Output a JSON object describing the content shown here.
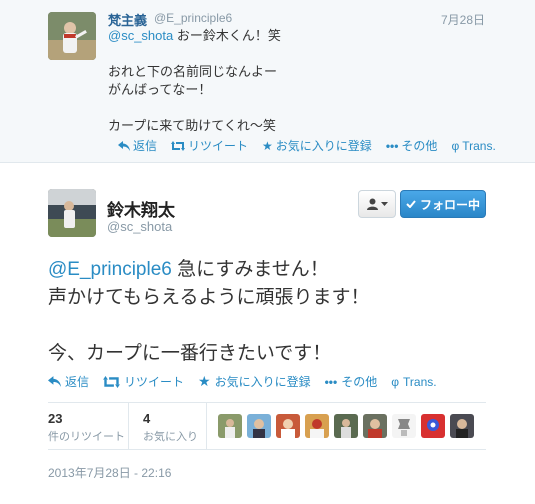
{
  "reply_tweet": {
    "name": "梵主義",
    "handle": "@E_principle6",
    "time": "7月28日",
    "mention": "@sc_shota",
    "body": " おー鈴木くん！笑\n\nおれと下の名前同じなんよー\nがんばってなー！\n\nカープに来て助けてくれ〜笑",
    "actions": {
      "reply": "返信",
      "retweet": "リツイート",
      "favorite": "お気に入りに登録",
      "more": "その他",
      "translate": "Trans."
    }
  },
  "main_tweet": {
    "name": "鈴木翔太",
    "handle": "@sc_shota",
    "follow_label": "フォロー中",
    "mention": "@E_principle6",
    "body": " 急にすみません！\n声かけてもらえるように頑張ります！\n\n今、カープに一番行きたいです！",
    "actions": {
      "reply": "返信",
      "retweet": "リツイート",
      "favorite": "お気に入りに登録",
      "more": "その他",
      "translate": "Trans."
    },
    "retweet_count": "23",
    "retweet_label": "件のリツイート",
    "favorite_count": "4",
    "favorite_label": "お気に入り",
    "timestamp": "2013年7月28日 - 22:16"
  },
  "colors": {
    "link": "#2a8cc4",
    "follow_button": "#2a86c8",
    "muted": "#8899a6"
  },
  "icons": [
    "reply-icon",
    "retweet-icon",
    "star-icon",
    "more-dots-icon",
    "translate-icon",
    "user-icon",
    "caret-down-icon",
    "check-icon"
  ]
}
